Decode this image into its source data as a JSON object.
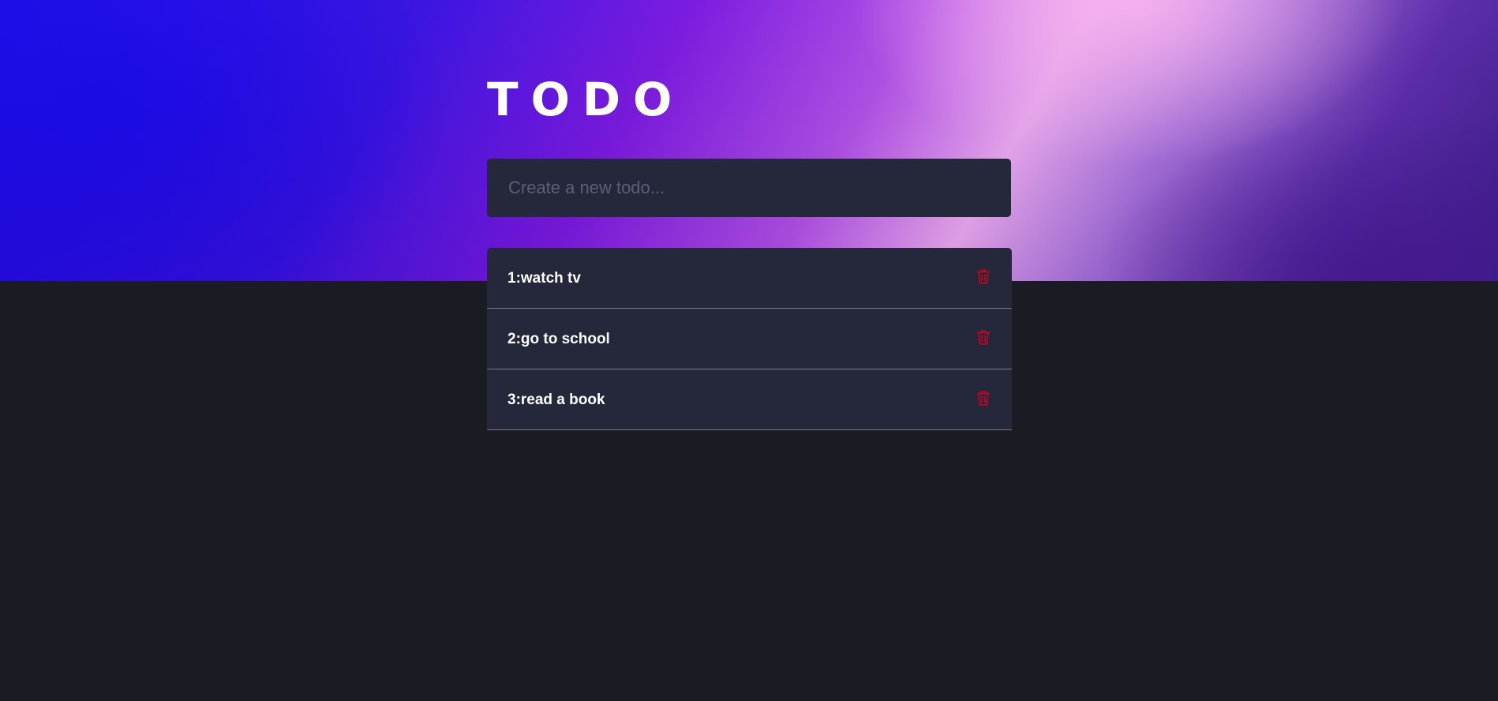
{
  "header": {
    "title": "TODO"
  },
  "new_todo": {
    "placeholder": "Create a new todo..."
  },
  "todos": [
    {
      "label": "1:watch tv"
    },
    {
      "label": "2:go to school"
    },
    {
      "label": "3:read a book"
    }
  ],
  "icons": {
    "delete": "trash-icon"
  },
  "colors": {
    "background": "#1b1b24",
    "panel": "#25273a",
    "delete_icon": "#d2001f",
    "text": "#ffffff",
    "placeholder": "#5c5f78"
  }
}
